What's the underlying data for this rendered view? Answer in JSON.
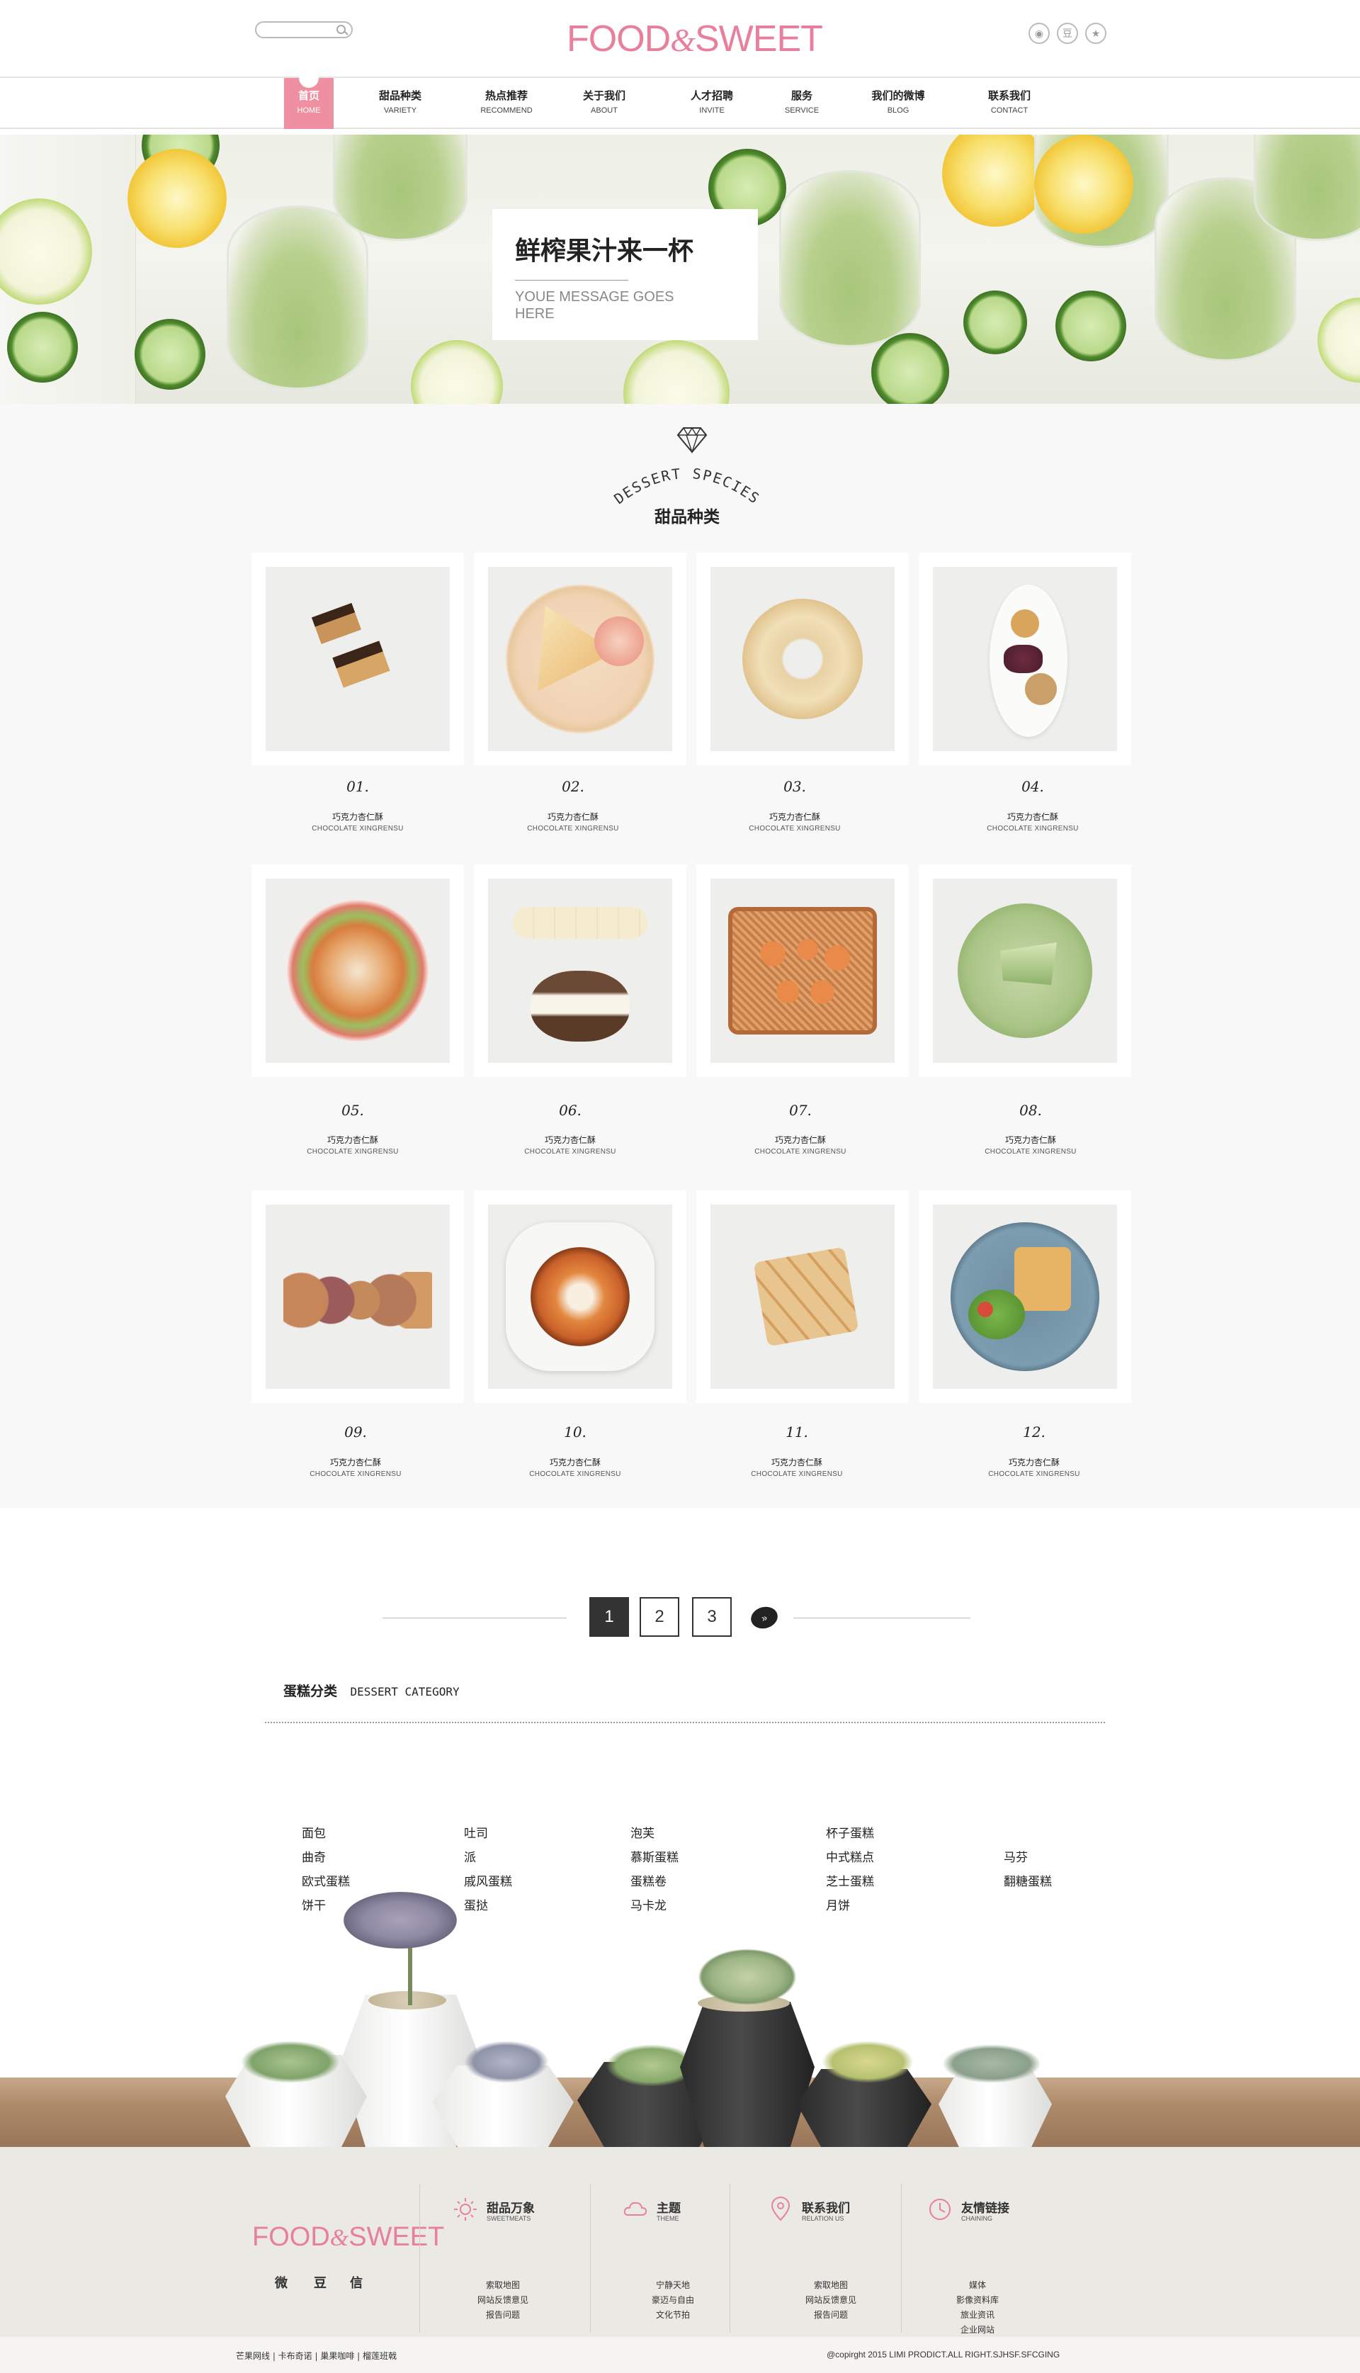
{
  "header": {
    "search_placeholder": "",
    "logo_main": "FOOD",
    "logo_amp": "&",
    "logo_tail": "SWEET",
    "social": [
      "weibo-icon",
      "douban-icon",
      "star-icon"
    ]
  },
  "nav": {
    "items": [
      {
        "cn": "首页",
        "en": "HOME",
        "active": true
      },
      {
        "cn": "甜品种类",
        "en": "VARIETY"
      },
      {
        "cn": "热点推荐",
        "en": "RECOMMEND"
      },
      {
        "cn": "关于我们",
        "en": "ABOUT"
      },
      {
        "cn": "人才招聘",
        "en": "INVITE"
      },
      {
        "cn": "服务",
        "en": "SERVICE"
      },
      {
        "cn": "我们的微博",
        "en": "BLOG"
      },
      {
        "cn": "联系我们",
        "en": "CONTACT"
      }
    ]
  },
  "banner": {
    "title": "鲜榨果汁来一杯",
    "message": "YOUE MESSAGE GOES HERE"
  },
  "species": {
    "arc_title": "DESSERT SPECIES",
    "title_cn": "甜品种类",
    "items": [
      {
        "num": "01.",
        "cn": "巧克力杏仁酥",
        "en": "CHOCOLATE XINGRENSU"
      },
      {
        "num": "02.",
        "cn": "巧克力杏仁酥",
        "en": "CHOCOLATE XINGRENSU"
      },
      {
        "num": "03.",
        "cn": "巧克力杏仁酥",
        "en": "CHOCOLATE XINGRENSU"
      },
      {
        "num": "04.",
        "cn": "巧克力杏仁酥",
        "en": "CHOCOLATE XINGRENSU"
      },
      {
        "num": "05.",
        "cn": "巧克力杏仁酥",
        "en": "CHOCOLATE XINGRENSU"
      },
      {
        "num": "06.",
        "cn": "巧克力杏仁酥",
        "en": "CHOCOLATE XINGRENSU"
      },
      {
        "num": "07.",
        "cn": "巧克力杏仁酥",
        "en": "CHOCOLATE XINGRENSU"
      },
      {
        "num": "08.",
        "cn": "巧克力杏仁酥",
        "en": "CHOCOLATE XINGRENSU"
      },
      {
        "num": "09.",
        "cn": "巧克力杏仁酥",
        "en": "CHOCOLATE XINGRENSU"
      },
      {
        "num": "10.",
        "cn": "巧克力杏仁酥",
        "en": "CHOCOLATE XINGRENSU"
      },
      {
        "num": "11.",
        "cn": "巧克力杏仁酥",
        "en": "CHOCOLATE XINGRENSU"
      },
      {
        "num": "12.",
        "cn": "巧克力杏仁酥",
        "en": "CHOCOLATE XINGRENSU"
      }
    ]
  },
  "pagination": {
    "pages": [
      "1",
      "2",
      "3"
    ],
    "current": "1",
    "next": "»"
  },
  "category": {
    "title_cn": "蛋糕分类",
    "title_en": "DESSERT CATEGORY",
    "columns": [
      [
        "面包",
        "曲奇",
        "欧式蛋糕",
        "饼干"
      ],
      [
        "吐司",
        "派",
        "戚风蛋糕",
        "蛋挞"
      ],
      [
        "泡芙",
        "慕斯蛋糕",
        "蛋糕卷",
        "马卡龙"
      ],
      [
        "杯子蛋糕",
        "中式糕点",
        "芝士蛋糕",
        "月饼"
      ],
      [
        "马芬",
        "翻糖蛋糕"
      ]
    ]
  },
  "footer": {
    "logo_main": "FOOD",
    "logo_amp": "&",
    "logo_tail": "SWEET",
    "social": [
      "微",
      "豆",
      "信"
    ],
    "columns": [
      {
        "title": "甜品万象",
        "sub": "SWEETMEATS",
        "icon": "sun-icon",
        "links": [
          "索取地图",
          "网站反馈意见",
          "报告问题"
        ]
      },
      {
        "title": "主题",
        "sub": "THEME",
        "icon": "cloud-icon",
        "links": [
          "宁静天地",
          "豪迈与自由",
          "文化节拍"
        ]
      },
      {
        "title": "联系我们",
        "sub": "RELATION US",
        "icon": "location-pin-icon",
        "links": [
          "索取地图",
          "网站反馈意见",
          "报告问题"
        ]
      },
      {
        "title": "友情链接",
        "sub": "CHAINING",
        "icon": "clock-icon",
        "links": [
          "媒体",
          "影像资料库",
          "旅业资讯",
          "企业网站"
        ]
      }
    ]
  },
  "bottom": {
    "left": "芒果网线 | 卡布奇诺 | 巢果咖啡 | 榴莲班戟",
    "right": "@copirght 2015 LIMI PRODICT.ALL RIGHT.SJHSF.SFCGING"
  },
  "colors": {
    "accent": "#ef8fa2",
    "logo": "#e8809b"
  }
}
